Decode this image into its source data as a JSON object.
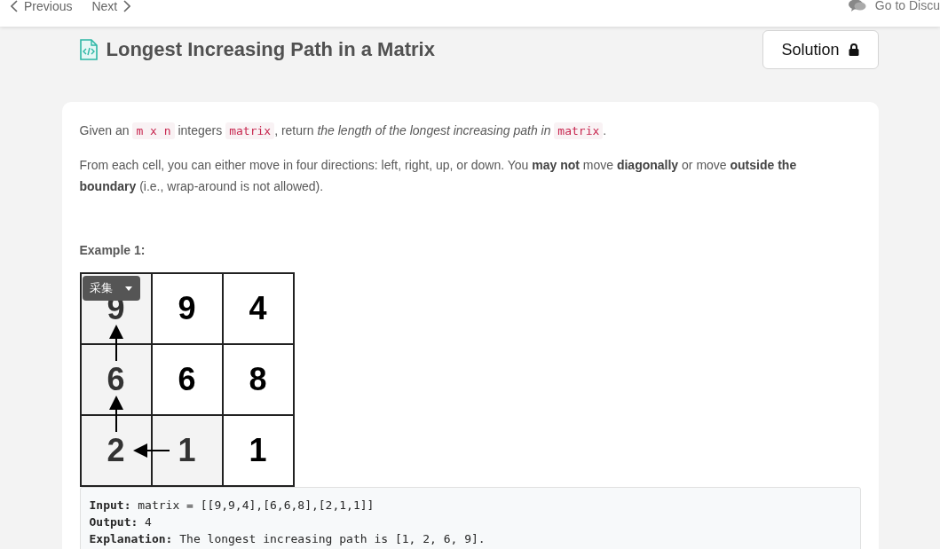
{
  "nav": {
    "previous": "Previous",
    "next": "Next",
    "discuss": "Go to Discu"
  },
  "title": "Longest Increasing Path in a Matrix",
  "solution_button": {
    "label": "Solution",
    "locked": true
  },
  "description": [
    [
      {
        "kind": "text",
        "text": "Given an "
      },
      {
        "kind": "code",
        "text": "m x n"
      },
      {
        "kind": "text",
        "text": " integers "
      },
      {
        "kind": "code",
        "text": "matrix"
      },
      {
        "kind": "text",
        "text": ", return *the length of the longest increasing path in* "
      },
      {
        "kind": "code",
        "text": "matrix"
      },
      {
        "kind": "text",
        "text": "."
      }
    ],
    [
      {
        "kind": "text",
        "text": "From each cell, you can either move in four directions: left, right, up, or down. You **may not** move **diagonally** or move **outside the boundary** (i.e., wrap-around is not allowed)."
      }
    ]
  ],
  "example": {
    "heading": "Example 1:",
    "grid": [
      [
        {
          "value": "9",
          "on_path": true
        },
        {
          "value": "9",
          "on_path": false
        },
        {
          "value": "4",
          "on_path": false
        }
      ],
      [
        {
          "value": "6",
          "on_path": true
        },
        {
          "value": "6",
          "on_path": false
        },
        {
          "value": "8",
          "on_path": false
        }
      ],
      [
        {
          "value": "2",
          "on_path": true
        },
        {
          "value": "1",
          "on_path": true
        },
        {
          "value": "1",
          "on_path": false
        }
      ]
    ],
    "overlay_button": "采集",
    "lines": [
      {
        "label": "Input:",
        "value": " matrix = [[9,9,4],[6,6,8],[2,1,1]]"
      },
      {
        "label": "Output:",
        "value": " 4"
      },
      {
        "label": "Explanation:",
        "value": " The longest increasing path is [1, 2, 6, 9]."
      }
    ]
  }
}
